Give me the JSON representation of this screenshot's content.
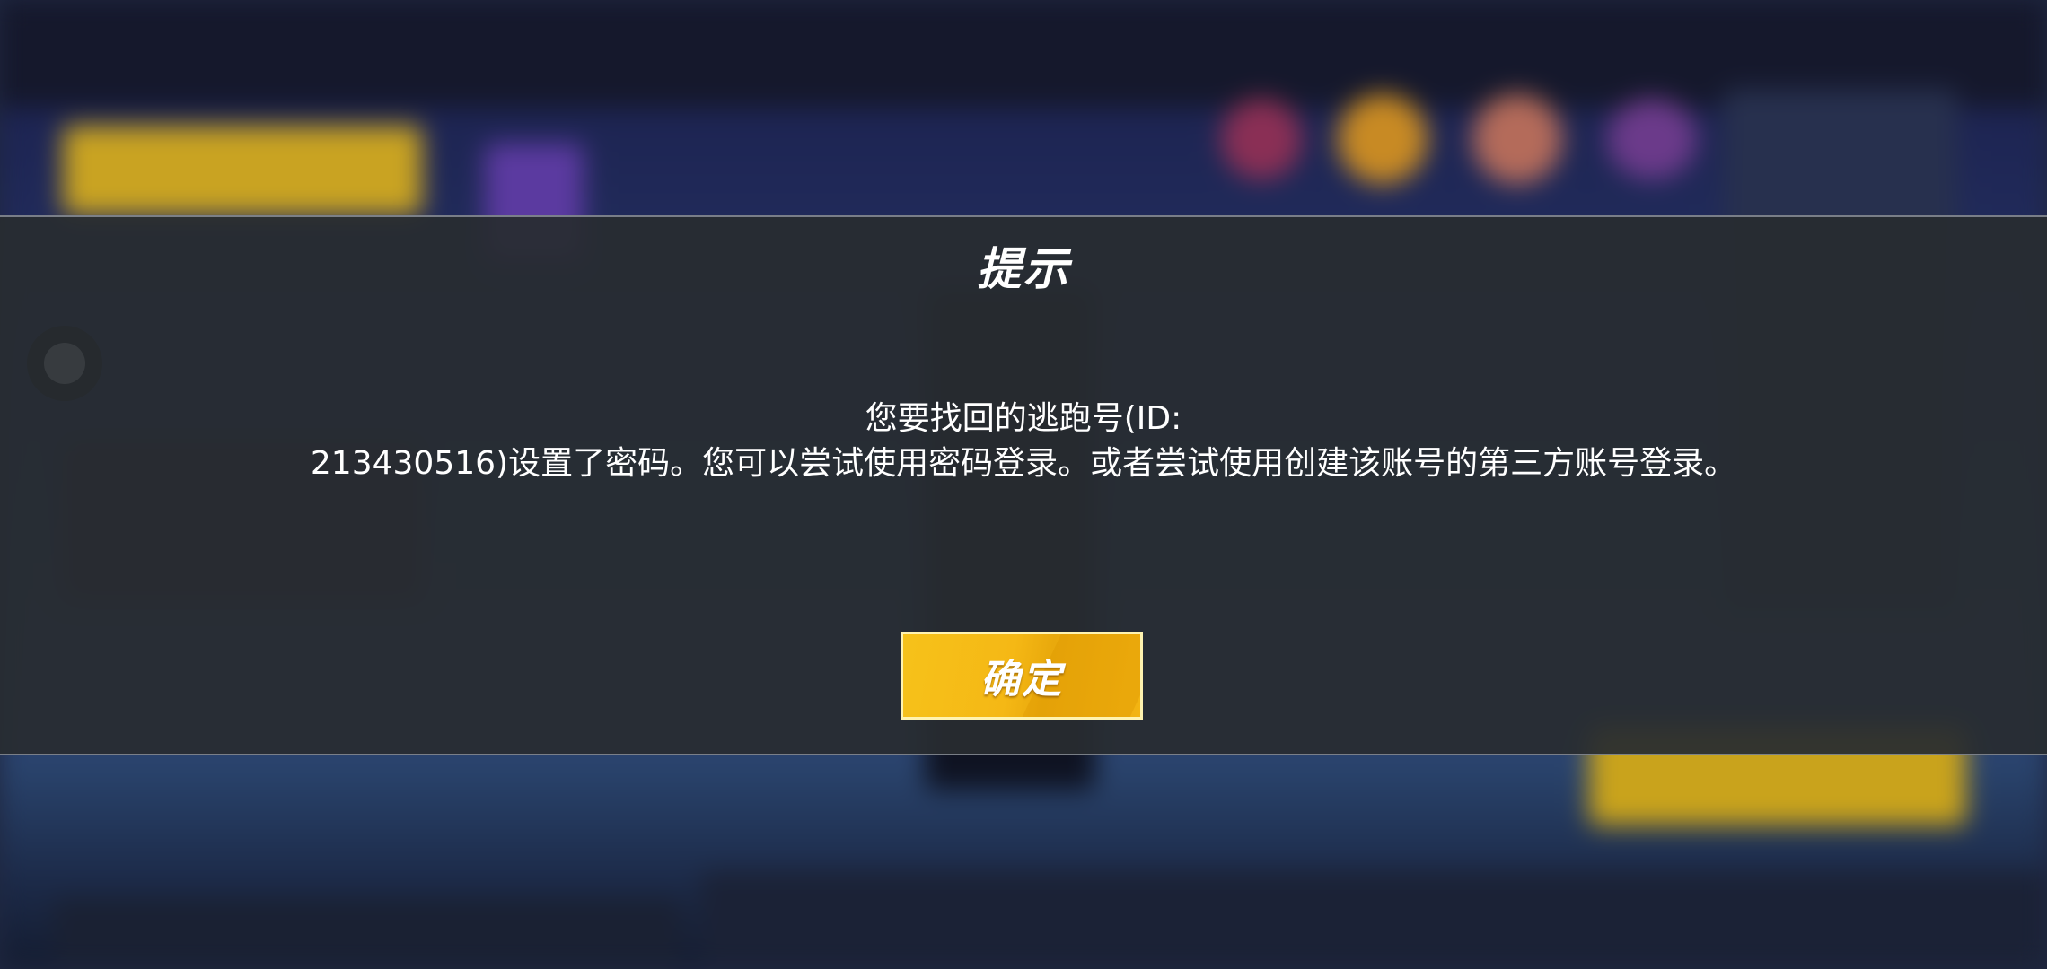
{
  "dialog": {
    "title": "提示",
    "message_line1": "您要找回的逃跑号(ID:",
    "message_line2": "213430516)设置了密码。您可以尝试使用密码登录。或者尝试使用创建该账号的第三方账号登录。",
    "confirm_label": "确定"
  },
  "floating_button": {
    "icon": "assistive-touch-icon"
  },
  "colors": {
    "overlay": "#2a2d31",
    "accent_button": "#f5b815",
    "text": "#ffffff"
  }
}
